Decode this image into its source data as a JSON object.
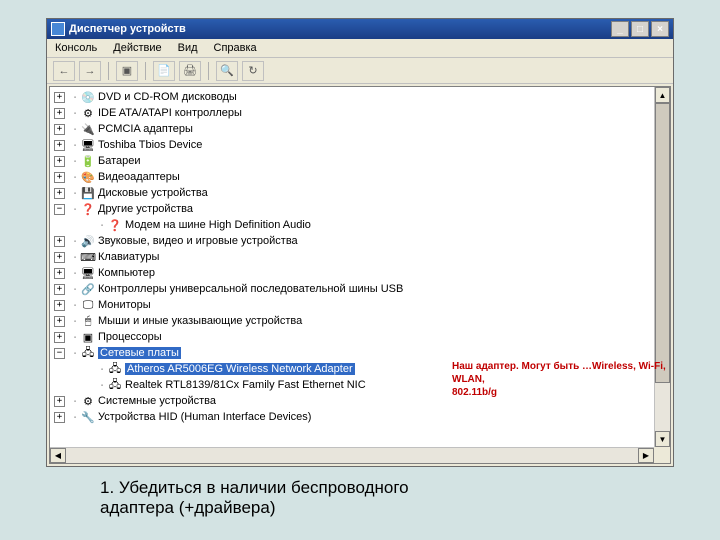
{
  "window": {
    "title": "Диспетчер устройств",
    "buttons": {
      "min": "_",
      "max": "□",
      "close": "×"
    }
  },
  "menubar": [
    "Консоль",
    "Действие",
    "Вид",
    "Справка"
  ],
  "tree": [
    {
      "icon": "💿",
      "label": "DVD и CD-ROM дисководы",
      "twisty": "+",
      "level": 0
    },
    {
      "icon": "⚙",
      "label": "IDE ATA/ATAPI контроллеры",
      "twisty": "+",
      "level": 0
    },
    {
      "icon": "🔌",
      "label": "PCMCIA адаптеры",
      "twisty": "+",
      "level": 0
    },
    {
      "icon": "🖥",
      "label": "Toshiba Tbios Device",
      "twisty": "+",
      "level": 0
    },
    {
      "icon": "🔋",
      "label": "Батареи",
      "twisty": "+",
      "level": 0
    },
    {
      "icon": "🎨",
      "label": "Видеоадаптеры",
      "twisty": "+",
      "level": 0
    },
    {
      "icon": "💾",
      "label": "Дисковые устройства",
      "twisty": "+",
      "level": 0
    },
    {
      "icon": "❓",
      "label": "Другие устройства",
      "twisty": "−",
      "level": 0
    },
    {
      "icon": "❓",
      "label": "Модем на шине High Definition Audio",
      "twisty": "",
      "level": 1
    },
    {
      "icon": "🔊",
      "label": "Звуковые, видео и игровые устройства",
      "twisty": "+",
      "level": 0
    },
    {
      "icon": "⌨",
      "label": "Клавиатуры",
      "twisty": "+",
      "level": 0
    },
    {
      "icon": "🖥",
      "label": "Компьютер",
      "twisty": "+",
      "level": 0
    },
    {
      "icon": "🔗",
      "label": "Контроллеры универсальной последовательной шины USB",
      "twisty": "+",
      "level": 0
    },
    {
      "icon": "🖵",
      "label": "Мониторы",
      "twisty": "+",
      "level": 0
    },
    {
      "icon": "🖱",
      "label": "Мыши и иные указывающие устройства",
      "twisty": "+",
      "level": 0
    },
    {
      "icon": "▣",
      "label": "Процессоры",
      "twisty": "+",
      "level": 0
    },
    {
      "icon": "🖧",
      "label": "Сетевые платы",
      "twisty": "−",
      "level": 0,
      "selected": true
    },
    {
      "icon": "🖧",
      "label": "Atheros AR5006EG Wireless Network Adapter",
      "twisty": "",
      "level": 1,
      "highlight": true
    },
    {
      "icon": "🖧",
      "label": "Realtek RTL8139/81Cx Family Fast Ethernet NIC",
      "twisty": "",
      "level": 1
    },
    {
      "icon": "⚙",
      "label": "Системные устройства",
      "twisty": "+",
      "level": 0
    },
    {
      "icon": "🔧",
      "label": "Устройства HID (Human Interface Devices)",
      "twisty": "+",
      "level": 0
    }
  ],
  "annotation": {
    "line1": "Наш адаптер. Могут быть …Wireless,  Wi-Fi, WLAN,",
    "line2": "802.11b/g"
  },
  "caption": "1. Убедиться в наличии беспроводного\nадаптера (+драйвера)"
}
